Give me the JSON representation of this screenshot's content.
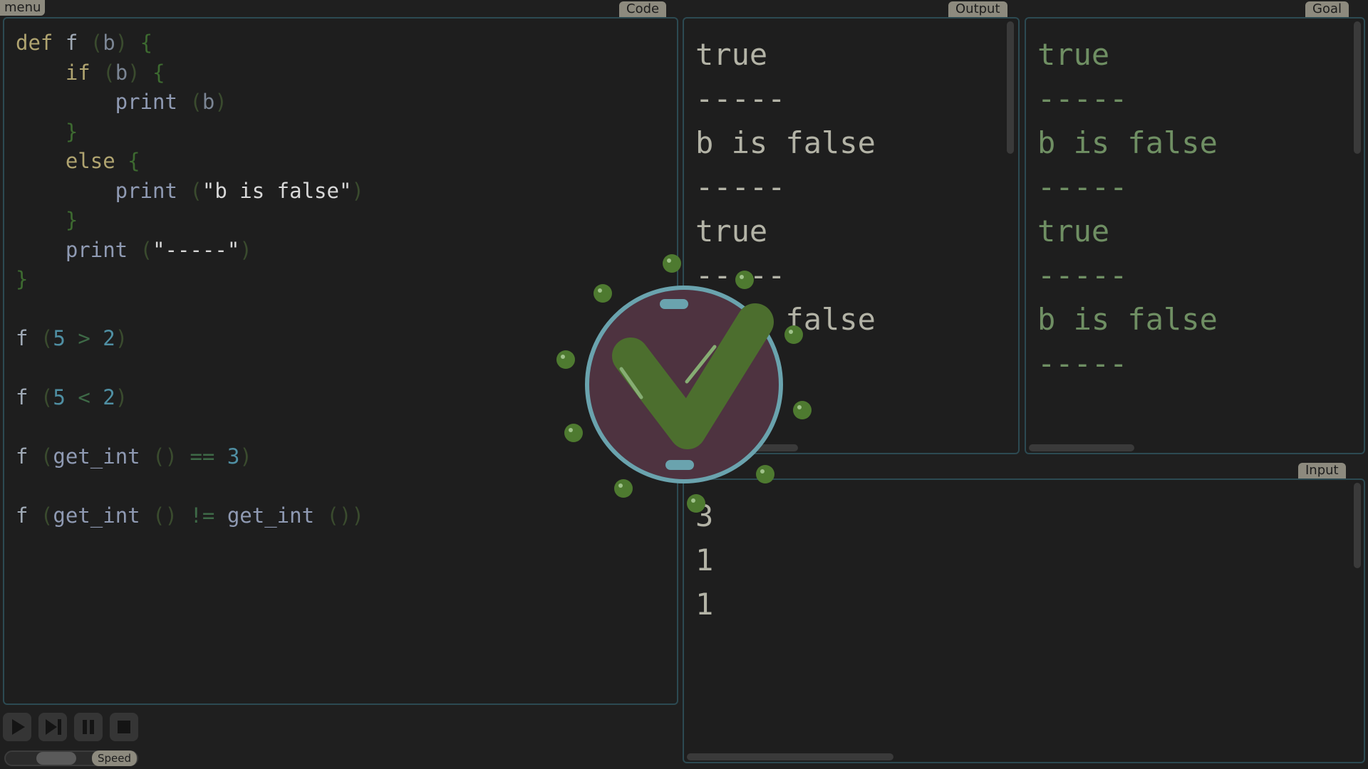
{
  "menu": {
    "label": "menu"
  },
  "code_panel": {
    "tab": "Code",
    "lines": [
      [
        [
          "kw",
          "def"
        ],
        [
          "fnname",
          " f "
        ],
        [
          "paren",
          "("
        ],
        [
          "ident",
          "b"
        ],
        [
          "paren",
          ")"
        ],
        [
          "brace",
          " {"
        ]
      ],
      [
        [
          "kw",
          "    if "
        ],
        [
          "paren",
          "("
        ],
        [
          "ident",
          "b"
        ],
        [
          "paren",
          ")"
        ],
        [
          "brace",
          " {"
        ]
      ],
      [
        [
          "fn",
          "        print "
        ],
        [
          "paren",
          "("
        ],
        [
          "ident",
          "b"
        ],
        [
          "paren",
          ")"
        ]
      ],
      [
        [
          "brace",
          "    }"
        ]
      ],
      [
        [
          "kw",
          "    else "
        ],
        [
          "brace",
          "{"
        ]
      ],
      [
        [
          "fn",
          "        print "
        ],
        [
          "paren",
          "("
        ],
        [
          "str",
          "\"b is false\""
        ],
        [
          "paren",
          ")"
        ]
      ],
      [
        [
          "brace",
          "    }"
        ]
      ],
      [
        [
          "fn",
          "    print "
        ],
        [
          "paren",
          "("
        ],
        [
          "str",
          "\"-----\""
        ],
        [
          "paren",
          ")"
        ]
      ],
      [
        [
          "brace",
          "}"
        ]
      ],
      [],
      [
        [
          "fnname",
          "f "
        ],
        [
          "paren",
          "("
        ],
        [
          "num",
          "5"
        ],
        [
          "op",
          " > "
        ],
        [
          "num",
          "2"
        ],
        [
          "paren",
          ")"
        ]
      ],
      [],
      [
        [
          "fnname",
          "f "
        ],
        [
          "paren",
          "("
        ],
        [
          "num",
          "5"
        ],
        [
          "op",
          " < "
        ],
        [
          "num",
          "2"
        ],
        [
          "paren",
          ")"
        ]
      ],
      [],
      [
        [
          "fnname",
          "f "
        ],
        [
          "paren",
          "("
        ],
        [
          "fn",
          "get_int "
        ],
        [
          "paren",
          "()"
        ],
        [
          "op",
          " == "
        ],
        [
          "num",
          "3"
        ],
        [
          "paren",
          ")"
        ]
      ],
      [],
      [
        [
          "fnname",
          "f "
        ],
        [
          "paren",
          "("
        ],
        [
          "fn",
          "get_int "
        ],
        [
          "paren",
          "()"
        ],
        [
          "op",
          " != "
        ],
        [
          "fn",
          "get_int "
        ],
        [
          "paren",
          "())"
        ]
      ]
    ]
  },
  "output_panel": {
    "tab": "Output",
    "lines": [
      "true",
      "-----",
      "b is false",
      "-----",
      "true",
      "-----",
      "b is false",
      "-----"
    ]
  },
  "goal_panel": {
    "tab": "Goal",
    "lines": [
      "true",
      "-----",
      "b is false",
      "-----",
      "true",
      "-----",
      "b is false",
      "-----"
    ]
  },
  "input_panel": {
    "tab": "Input",
    "lines": [
      "3",
      "1",
      "1"
    ]
  },
  "controls": {
    "buttons": [
      {
        "icon": "play-icon"
      },
      {
        "icon": "step-icon"
      },
      {
        "icon": "pause-icon"
      },
      {
        "icon": "stop-icon"
      }
    ],
    "speed_label": "Speed",
    "speed_level": 0.55
  },
  "success_badge": {
    "icon": "checkmark-icon"
  },
  "colors": {
    "panel_border": "#2c4a52",
    "tag_bg": "#8d8a7e",
    "badge_fill": "#4e3340",
    "badge_ring": "#6aa3ae",
    "check_green": "#4c6e2e",
    "dot_green": "#4e7a30"
  }
}
